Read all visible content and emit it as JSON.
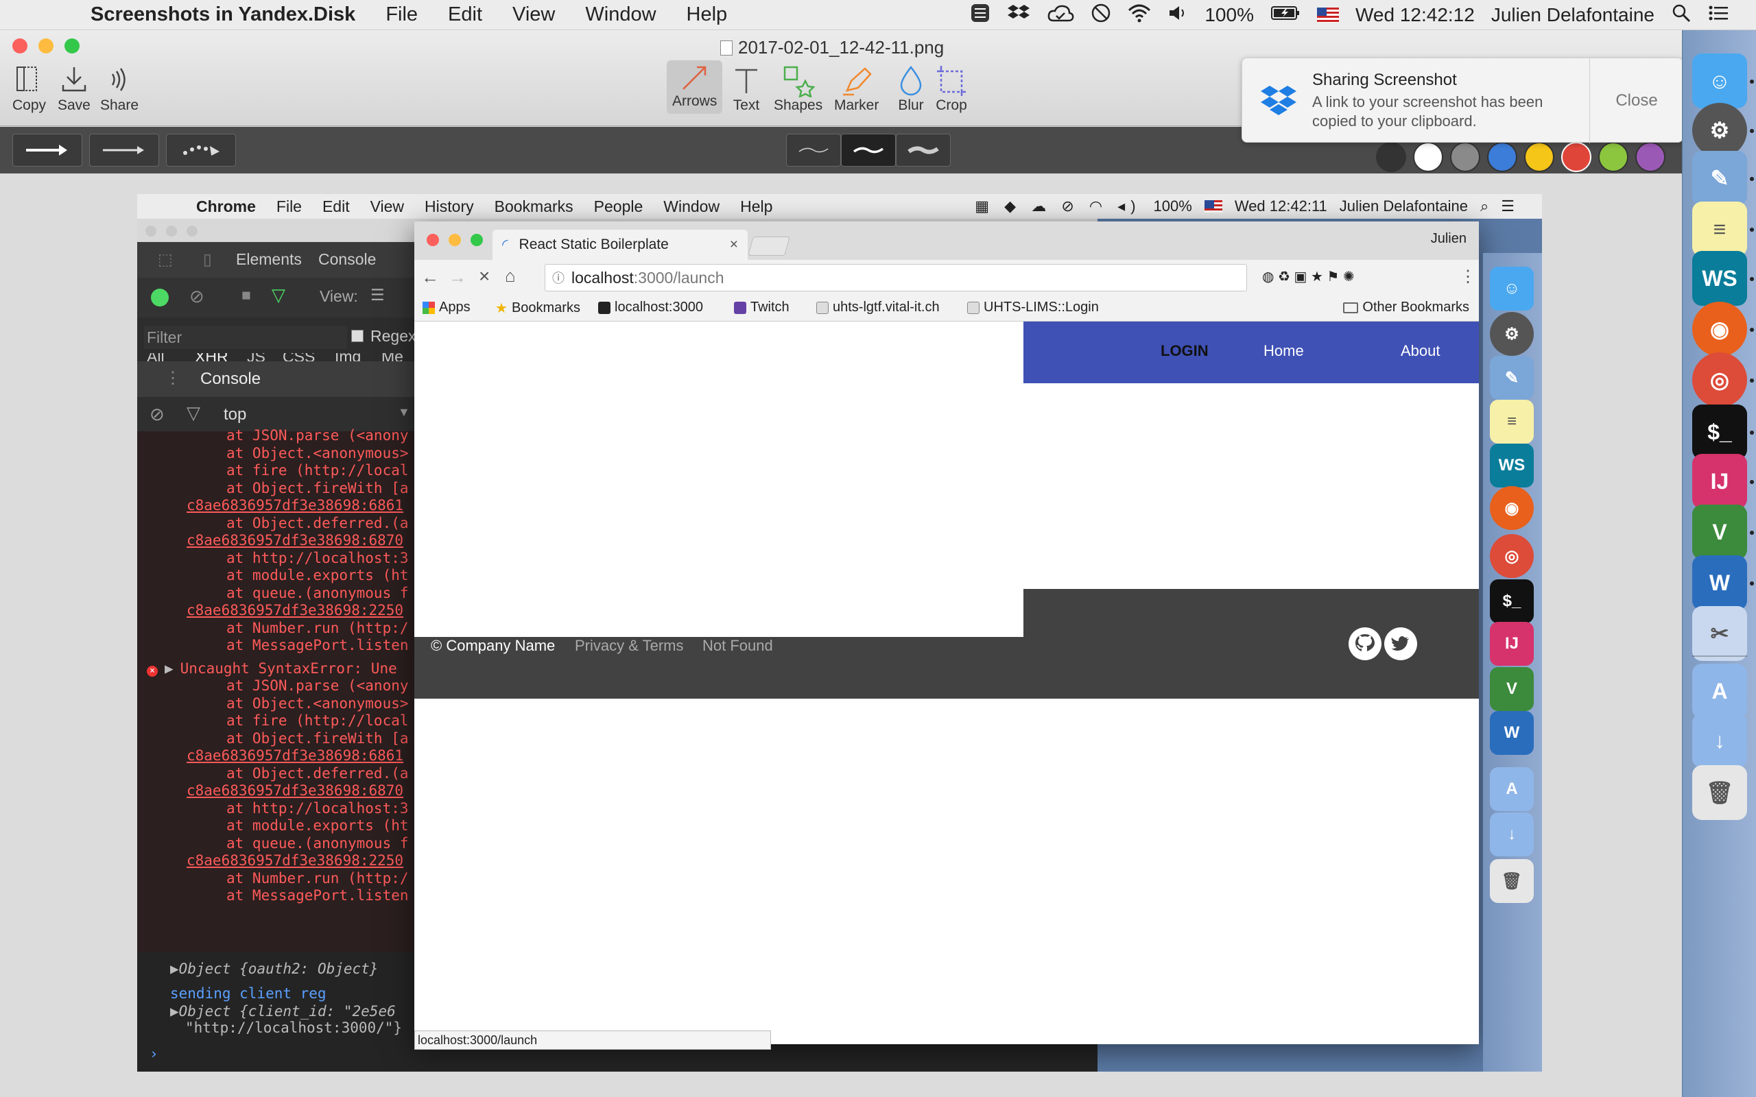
{
  "menubar": {
    "app_name": "Screenshots in Yandex.Disk",
    "menus": [
      "File",
      "Edit",
      "View",
      "Window",
      "Help"
    ],
    "battery": "100%",
    "datetime": "Wed 12:42:12",
    "user": "Julien Delafontaine"
  },
  "editor": {
    "filename": "2017-02-01_12-42-11.png",
    "left_tools": [
      {
        "label": "Copy",
        "icon": "copy-icon"
      },
      {
        "label": "Save",
        "icon": "save-icon"
      },
      {
        "label": "Share",
        "icon": "share-icon"
      }
    ],
    "tools": [
      {
        "label": "Arrows",
        "icon": "arrow-icon"
      },
      {
        "label": "Text",
        "icon": "text-icon"
      },
      {
        "label": "Shapes",
        "icon": "shapes-icon"
      },
      {
        "label": "Marker",
        "icon": "marker-icon"
      },
      {
        "label": "Blur",
        "icon": "blur-icon"
      },
      {
        "label": "Crop",
        "icon": "crop-icon"
      }
    ],
    "active_tool": "Arrows",
    "colors": [
      "#333333",
      "#ffffff",
      "#8a8a8a",
      "#3b7dd8",
      "#f5c518",
      "#e0453a",
      "#8cc63f",
      "#9b59b6"
    ]
  },
  "notification": {
    "title": "Sharing Screenshot",
    "body": "A link to your screenshot has been copied to your clipboard.",
    "close_label": "Close"
  },
  "inner": {
    "menubar": {
      "app_name": "Chrome",
      "menus": [
        "File",
        "Edit",
        "View",
        "History",
        "Bookmarks",
        "People",
        "Window",
        "Help"
      ],
      "battery": "100%",
      "datetime": "Wed 12:42:11",
      "user": "Julien Delafontaine"
    },
    "devtools": {
      "tabs": [
        "Elements",
        "Console"
      ],
      "view_label": "View:",
      "filter_placeholder": "Filter",
      "regex_label": "Regex",
      "type_filters": [
        "All",
        "XHR",
        "JS",
        "CSS",
        "Img",
        "Me"
      ],
      "console_title": "Console",
      "context": "top",
      "log_lines_1": [
        "at JSON.parse (<anony",
        "at Object.<anonymous>",
        "at fire (http://local",
        "at Object.fireWith [a",
        "c8ae6836957df3e38698:6861",
        "at Object.deferred.(a",
        "c8ae6836957df3e38698:6870",
        "at http://localhost:3",
        "at module.exports (ht",
        "at queue.(anonymous f",
        "c8ae6836957df3e38698:2250",
        "at Number.run (http:/",
        "at MessagePort.listen"
      ],
      "error_title": "Uncaught SyntaxError: Une",
      "log_lines_2": [
        "at JSON.parse (<anony",
        "at Object.<anonymous>",
        "at fire (http://local",
        "at Object.fireWith [a",
        "c8ae6836957df3e38698:6861",
        "at Object.deferred.(a",
        "c8ae6836957df3e38698:6870",
        "at http://localhost:3",
        "at module.exports (ht",
        "at queue.(anonymous f",
        "c8ae6836957df3e38698:2250",
        "at Number.run (http:/",
        "at MessagePort.listen"
      ],
      "object_line": "Object {oauth2: Object}",
      "info_line": "sending client reg",
      "client_line_1": "Object {client_id: \"2e5e6",
      "client_line_2": "\"http://localhost:3000/\"}"
    },
    "chrome": {
      "tab_title": "React Static Boilerplate",
      "profile": "Julien",
      "url_host": "localhost",
      "url_path": ":3000/launch",
      "bookmarks": [
        "Apps",
        "Bookmarks",
        "localhost:3000",
        "Twitch",
        "uhts-lgtf.vital-it.ch",
        "UHTS-LIMS::Login"
      ],
      "other_bookmarks": "Other Bookmarks",
      "status_url": "localhost:3000/launch"
    },
    "page": {
      "nav": [
        "LOGIN",
        "Home",
        "About"
      ],
      "footer_company": "© Company Name",
      "footer_links": [
        "Privacy & Terms",
        "Not Found"
      ]
    }
  }
}
